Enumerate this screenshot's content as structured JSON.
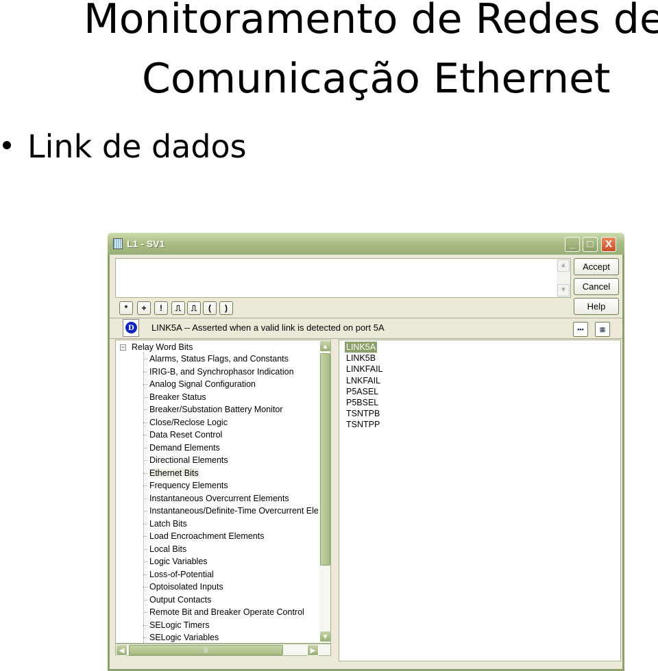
{
  "slide": {
    "title_line1": "Monitoramento de Redes de",
    "title_line2": "Comunicação Ethernet",
    "bullet": "Link de dados"
  },
  "window": {
    "title": "L1  - SV1",
    "minimize": "_",
    "maximize": "□",
    "close": "X",
    "buttons": {
      "accept": "Accept",
      "cancel": "Cancel",
      "help": "Help"
    },
    "toolbar": [
      "*",
      "+",
      "!",
      "⎍",
      "⎍",
      "(",
      ")"
    ],
    "description": "LINK5A -- Asserted when a valid link is detected on port 5A",
    "tree": {
      "root": "Relay Word Bits",
      "selected": "Ethernet Bits",
      "items": [
        "Alarms, Status Flags, and Constants",
        "IRIG-B, and Synchrophasor Indication",
        "Analog Signal Configuration",
        "Breaker Status",
        "Breaker/Substation Battery Monitor",
        "Close/Reclose Logic",
        "Data Reset Control",
        "Demand Elements",
        "Directional Elements",
        "Ethernet Bits",
        "Frequency Elements",
        "Instantaneous Overcurrent Elements",
        "Instantaneous/Definite-Time Overcurrent Ele",
        "Latch Bits",
        "Load Encroachment Elements",
        "Local Bits",
        "Logic Variables",
        "Loss-of-Potential",
        "Optoisolated Inputs",
        "Output Contacts",
        "Remote Bit and Breaker Operate Control",
        "SELogic Timers",
        "SELogic Variables"
      ]
    },
    "list": {
      "selected": "LINK5A",
      "items": [
        "LINK5A",
        "LINK5B",
        "LINKFAIL",
        "LNKFAIL",
        "P5ASEL",
        "P5BSEL",
        "TSNTPB",
        "TSNTPP"
      ]
    },
    "colors": {
      "theme": "#8ba169",
      "icon_d": "#1024c0"
    }
  }
}
